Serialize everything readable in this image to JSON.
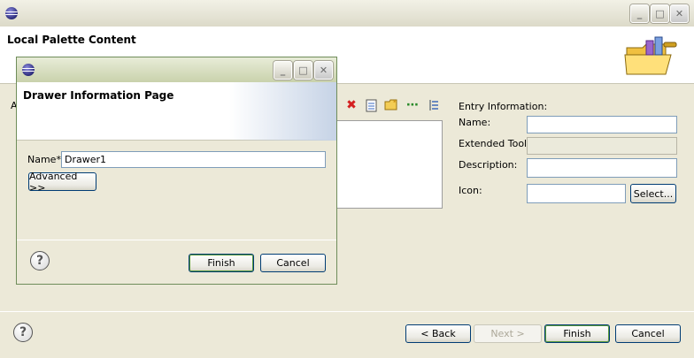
{
  "outer": {
    "title": "Local Palette Content",
    "entry_info": {
      "heading": "Entry Information:",
      "name_label": "Name:",
      "name_value": "",
      "extended_tool_label": "Extended Tool:",
      "extended_tool_value": "",
      "description_label": "Description:",
      "description_value": "",
      "icon_label": "Icon:",
      "icon_value": "",
      "select_button": "Select..."
    },
    "buttons": {
      "back": "< Back",
      "next": "Next >",
      "finish": "Finish",
      "cancel": "Cancel"
    },
    "help_glyph": "?",
    "clipped_letter": "A"
  },
  "dialog": {
    "page_title": "Drawer Information Page",
    "name_label": "Name*",
    "name_value": "Drawer1",
    "advanced_button": "Advanced >>",
    "finish_button": "Finish",
    "cancel_button": "Cancel",
    "help_glyph": "?"
  },
  "window_controls": {
    "minimize": "_",
    "maximize": "□",
    "close": "✕"
  }
}
